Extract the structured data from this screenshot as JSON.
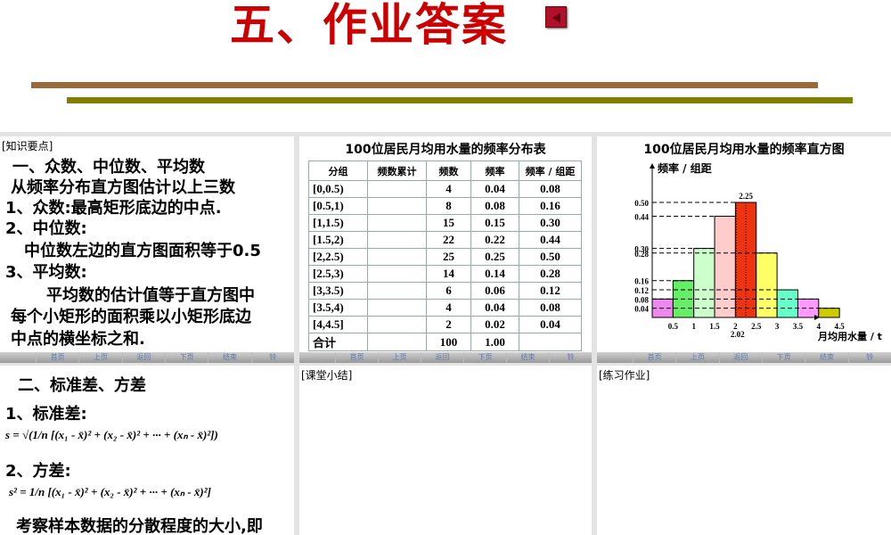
{
  "title": "五、作业答案",
  "nav": [
    "首页",
    "上页",
    "返回",
    "下页",
    "结束",
    "铃"
  ],
  "p1": {
    "tag": "[知识要点]",
    "lines": [
      "一、众数、中位数、平均数",
      "从频率分布直方图估计以上三数",
      "1、众数:最高矩形底边的中点.",
      "2、中位数:",
      "中位数左边的直方图面积等于0.5",
      "3、平均数:",
      "平均数的估计值等于直方图中",
      "每个小矩形的面积乘以小矩形底边",
      "中点的横坐标之和."
    ]
  },
  "p2": {
    "title": "100位居民月均用水量的频率分布表",
    "headers": [
      "分组",
      "频数累计",
      "频数",
      "频率",
      "频率 / 组距"
    ],
    "rows": [
      [
        "[0,0.5)",
        "",
        "4",
        "0.04",
        "0.08"
      ],
      [
        "[0.5,1)",
        "",
        "8",
        "0.08",
        "0.16"
      ],
      [
        "[1,1.5)",
        "",
        "15",
        "0.15",
        "0.30"
      ],
      [
        "[1.5,2)",
        "",
        "22",
        "0.22",
        "0.44"
      ],
      [
        "[2,2.5)",
        "",
        "25",
        "0.25",
        "0.50"
      ],
      [
        "[2.5,3)",
        "",
        "14",
        "0.14",
        "0.28"
      ],
      [
        "[3,3.5)",
        "",
        "6",
        "0.06",
        "0.12"
      ],
      [
        "[3.5,4)",
        "",
        "4",
        "0.04",
        "0.08"
      ],
      [
        "[4,4.5]",
        "",
        "2",
        "0.02",
        "0.04"
      ],
      [
        "合计",
        "",
        "100",
        "1.00",
        ""
      ]
    ]
  },
  "chart_data": {
    "type": "bar",
    "title": "100位居民月均用水量的频率直方图",
    "ylabel": "频率 / 组距",
    "xlabel": "月均用水量 / t",
    "bins": [
      [
        0,
        0.5
      ],
      [
        0.5,
        1
      ],
      [
        1,
        1.5
      ],
      [
        1.5,
        2
      ],
      [
        2,
        2.5
      ],
      [
        2.5,
        3
      ],
      [
        3,
        3.5
      ],
      [
        3.5,
        4
      ],
      [
        4,
        4.5
      ]
    ],
    "values": [
      0.08,
      0.16,
      0.3,
      0.44,
      0.5,
      0.28,
      0.12,
      0.08,
      0.04
    ],
    "colors": [
      "#ee88ee",
      "#66ee66",
      "#ccffcc",
      "#ffcccc",
      "#ee3311",
      "#ffff66",
      "#66ffcc",
      "#ff99ff",
      "#cccc00"
    ],
    "xticks": [
      "0.5",
      "1",
      "1.5",
      "2",
      "2.5",
      "3",
      "3.5",
      "4",
      "4.5"
    ],
    "yticks": [
      "0.50",
      "0.44",
      "0.30",
      "0.28",
      "0.16",
      "0.12",
      "0.08",
      "0.04"
    ],
    "annotations": {
      "top": "2.25",
      "bottom": "2.02"
    }
  },
  "p4": {
    "lines": [
      "二、标准差、方差",
      "1、标准差:",
      "2、方差:",
      "考察样本数据的分散程度的大小,即"
    ],
    "f1": "s = √(1/n [(x₁ - x̄)² + (x₂ - x̄)² + ··· + (xₙ - x̄)²])",
    "f2": "s² = 1/n [(x₁ - x̄)² + (x₂ - x̄)² + ··· + (xₙ - x̄)²]"
  },
  "p5": {
    "tag": "[课堂小结]"
  },
  "p6": {
    "tag": "[练习作业]"
  }
}
